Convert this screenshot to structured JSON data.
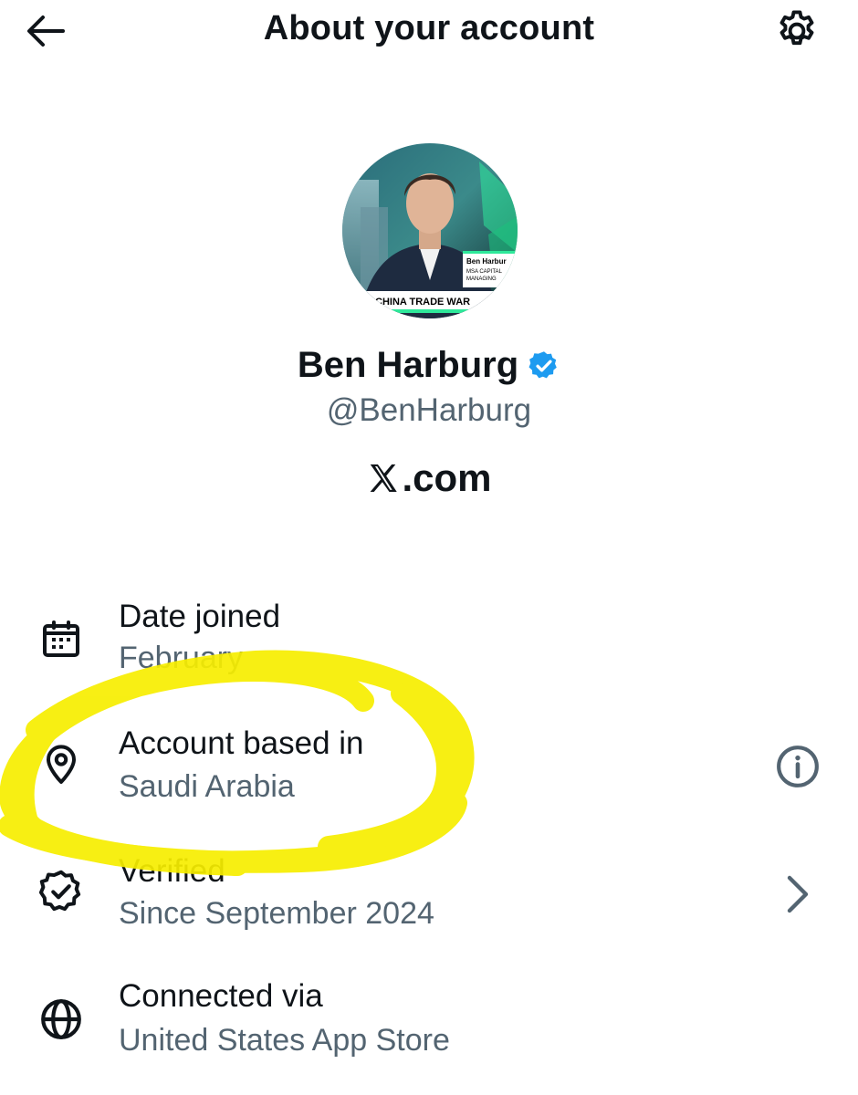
{
  "header": {
    "title": "About your account"
  },
  "profile": {
    "name": "Ben Harburg",
    "handle": "@BenHarburg",
    "site": ".com",
    "avatar_caption": {
      "name": "Ben Harbur",
      "line1": "MSA CAPITAL",
      "line2": "MANAGING",
      "banner": "CHINA TRADE WAR"
    }
  },
  "rows": [
    {
      "icon": "calendar-icon",
      "label": "Date joined",
      "value": "February"
    },
    {
      "icon": "location-pin-icon",
      "label": "Account based in",
      "value": "Saudi Arabia",
      "trailing": "info-icon"
    },
    {
      "icon": "verified-badge-icon",
      "label": "Verified",
      "value": "Since September 2024",
      "trailing": "chevron-right-icon"
    },
    {
      "icon": "globe-icon",
      "label": "Connected via",
      "value": "United States App Store"
    }
  ],
  "colors": {
    "text": "#0f1419",
    "secondary": "#536471",
    "verified_blue": "#1d9bf0",
    "highlight_yellow": "#f7ee00"
  }
}
